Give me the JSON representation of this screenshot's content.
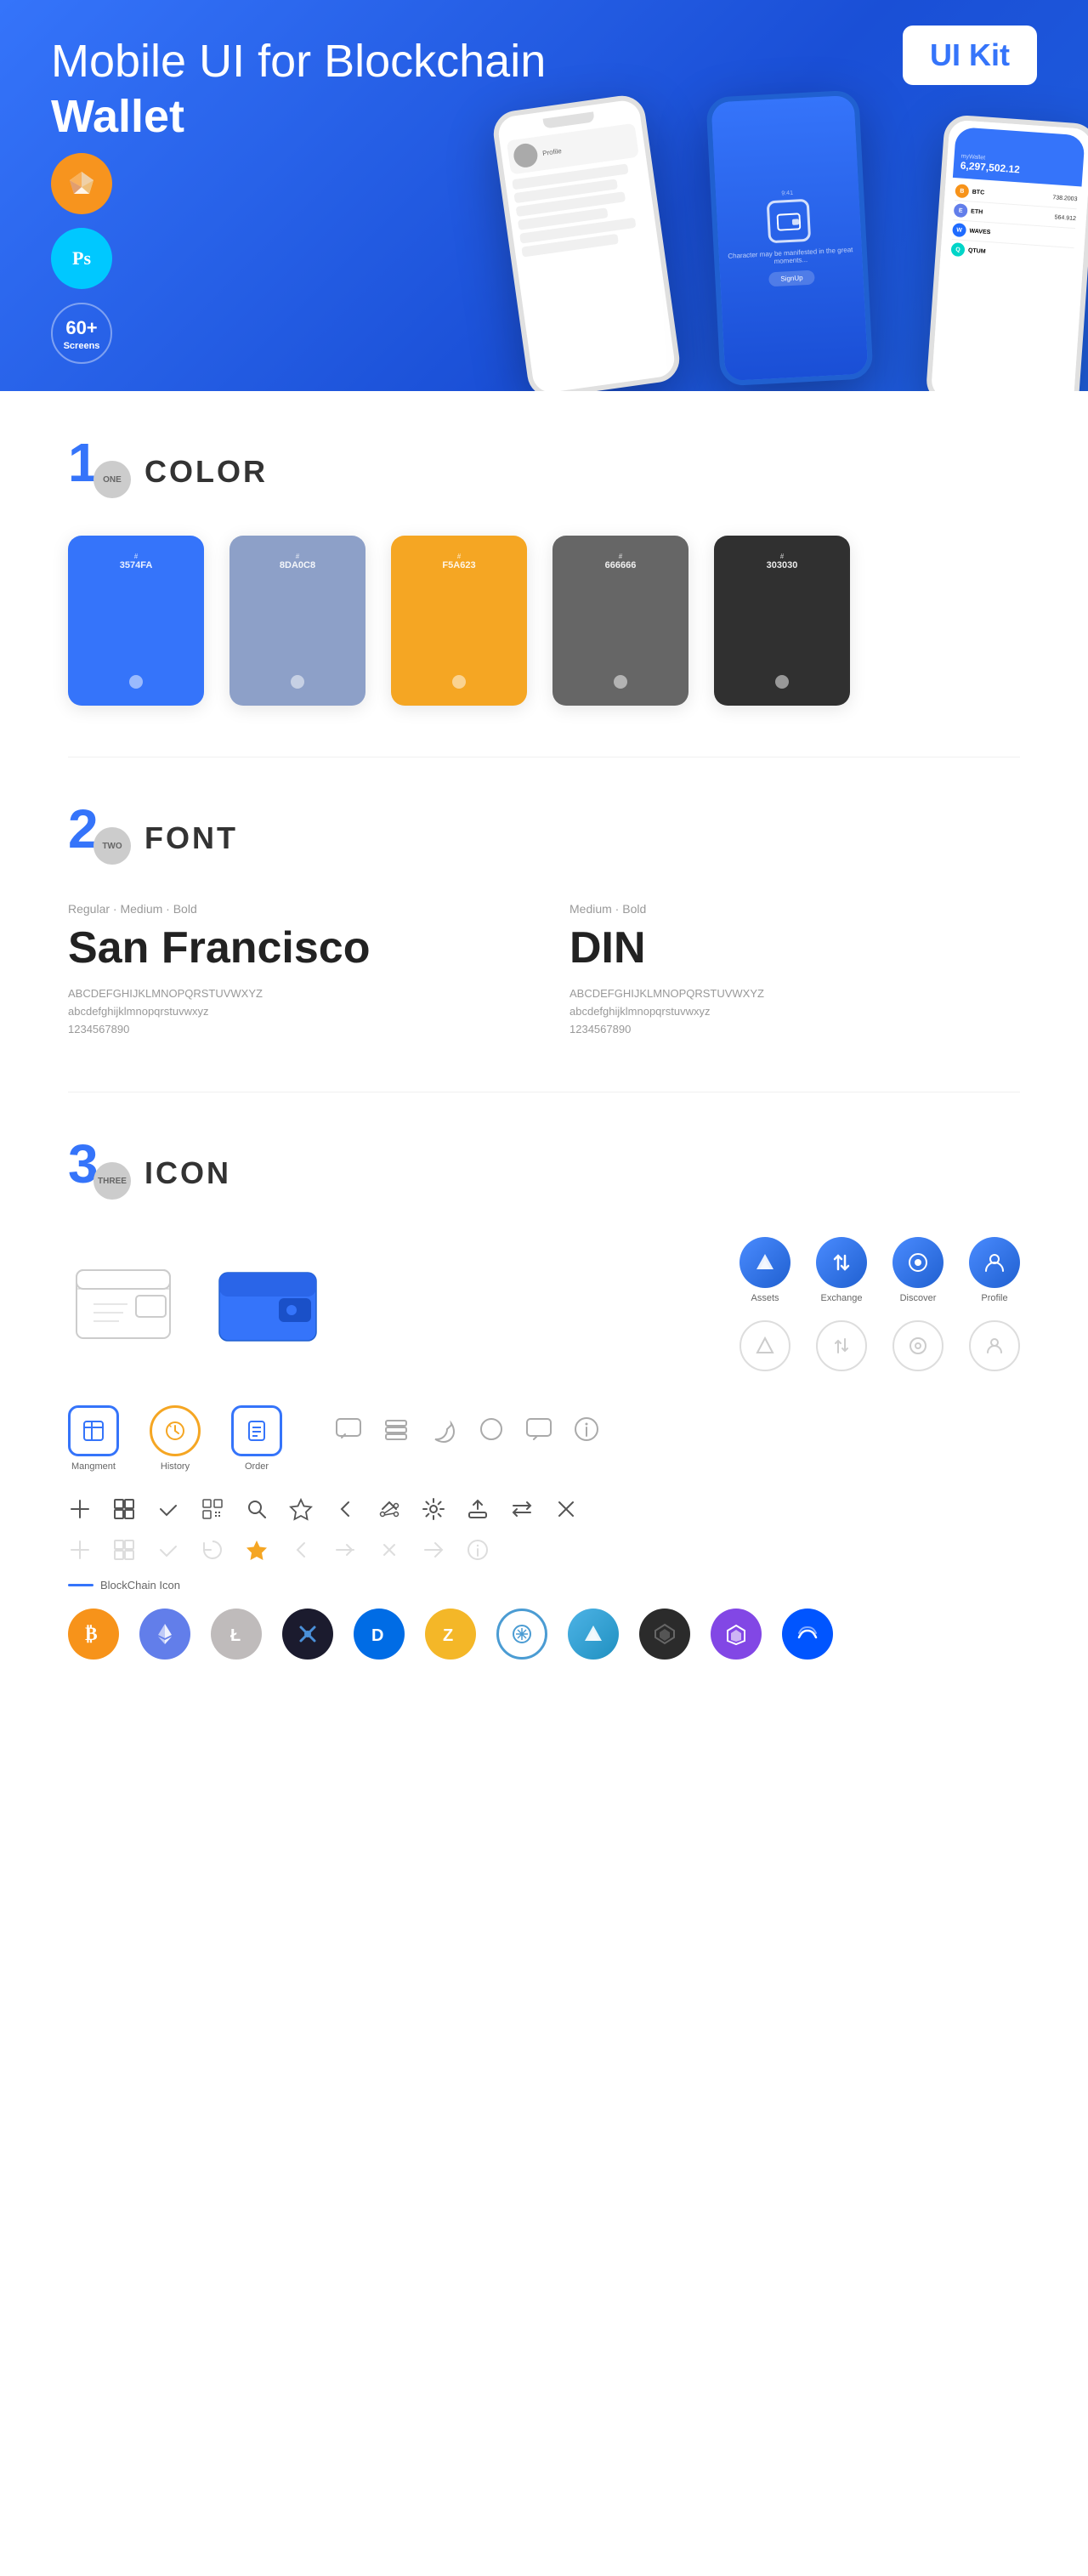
{
  "hero": {
    "title_regular": "Mobile UI for Blockchain ",
    "title_bold": "Wallet",
    "badge": "UI Kit",
    "badges": [
      {
        "label": "Sk",
        "type": "sketch"
      },
      {
        "label": "Ps",
        "type": "ps"
      },
      {
        "label": "60+",
        "sub": "Screens",
        "type": "screens"
      }
    ]
  },
  "sections": {
    "color": {
      "number": "1",
      "label": "ONE",
      "title": "COLOR",
      "swatches": [
        {
          "hex": "#3574FA",
          "code": "3574FA",
          "bg": "#3574FA"
        },
        {
          "hex": "#8DA0C8",
          "code": "8DA0C8",
          "bg": "#8DA0C8"
        },
        {
          "hex": "#F5A623",
          "code": "F5A623",
          "bg": "#F5A623"
        },
        {
          "hex": "#666666",
          "code": "666666",
          "bg": "#666666"
        },
        {
          "hex": "#303030",
          "code": "303030",
          "bg": "#303030"
        }
      ]
    },
    "font": {
      "number": "2",
      "label": "TWO",
      "title": "FONT",
      "fonts": [
        {
          "name": "San Francisco",
          "weight_label": "Regular · Medium · Bold",
          "uppercase": "ABCDEFGHIJKLMNOPQRSTUVWXYZ",
          "lowercase": "abcdefghijklmnopqrstuvwxyz",
          "numbers": "1234567890"
        },
        {
          "name": "DIN",
          "weight_label": "Medium · Bold",
          "uppercase": "ABCDEFGHIJKLMNOPQRSTUVWXYZ",
          "lowercase": "abcdefghijklmnopqrstuvwxyz",
          "numbers": "1234567890"
        }
      ]
    },
    "icon": {
      "number": "3",
      "label": "THREE",
      "title": "ICON",
      "nav_icons": [
        {
          "label": "Assets"
        },
        {
          "label": "Exchange"
        },
        {
          "label": "Discover"
        },
        {
          "label": "Profile"
        }
      ],
      "bottom_icons": [
        {
          "label": "Mangment"
        },
        {
          "label": "History"
        },
        {
          "label": "Order"
        }
      ],
      "blockchain_label": "BlockChain Icon",
      "crypto_coins": [
        {
          "symbol": "₿",
          "color": "#F7931A",
          "label": "Bitcoin"
        },
        {
          "symbol": "Ξ",
          "color": "#627EEA",
          "label": "Ethereum"
        },
        {
          "symbol": "Ł",
          "color": "#B8B8B8",
          "label": "Litecoin"
        },
        {
          "symbol": "◆",
          "color": "#1b1b2e",
          "label": "Verge"
        },
        {
          "symbol": "D",
          "color": "#006CE5",
          "label": "Dash"
        },
        {
          "symbol": "Z",
          "color": "#F4B728",
          "label": "Zcash"
        },
        {
          "symbol": "◈",
          "color": "#4B9CD3",
          "label": "Grid"
        },
        {
          "symbol": "▲",
          "color": "#4DB3E6",
          "label": "Steem"
        },
        {
          "symbol": "◇",
          "color": "#3E3E3E",
          "label": "Dark"
        },
        {
          "symbol": "◈",
          "color": "#FF5E01",
          "label": "Matic"
        },
        {
          "symbol": "~",
          "color": "#0044B4",
          "label": "Waves"
        }
      ]
    }
  }
}
